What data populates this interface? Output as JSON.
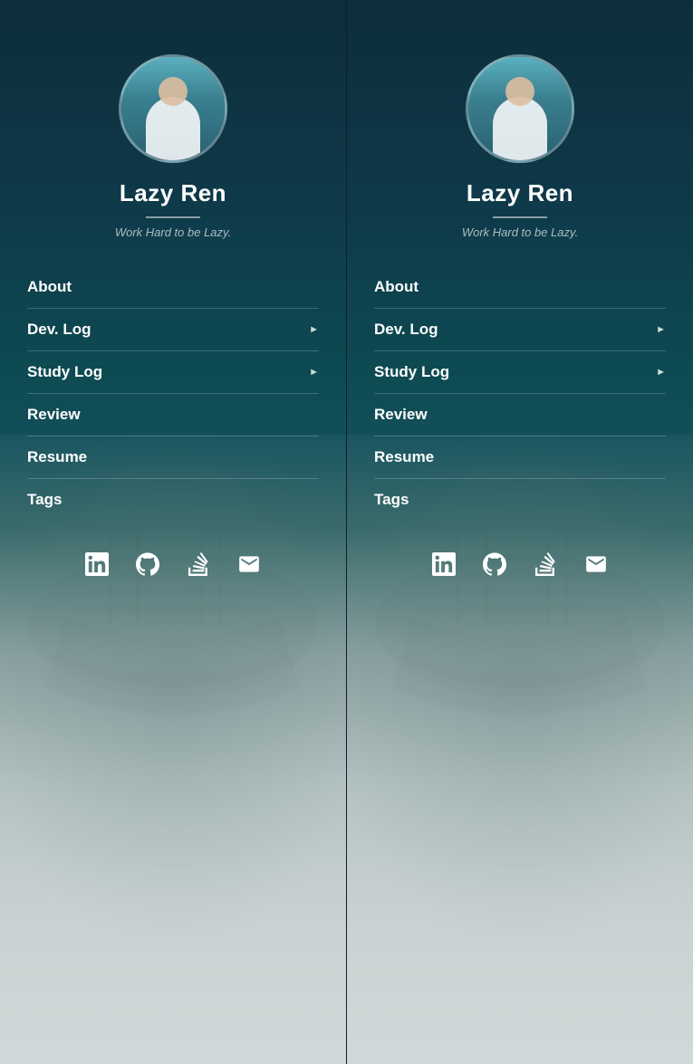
{
  "panels": [
    {
      "id": "panel-left",
      "profile": {
        "name": "Lazy Ren",
        "tagline": "Work Hard to be Lazy."
      },
      "nav": {
        "items": [
          {
            "label": "About",
            "hasArrow": false
          },
          {
            "label": "Dev. Log",
            "hasArrow": true
          },
          {
            "label": "Study Log",
            "hasArrow": true
          },
          {
            "label": "Review",
            "hasArrow": false
          },
          {
            "label": "Resume",
            "hasArrow": false
          },
          {
            "label": "Tags",
            "hasArrow": false
          }
        ]
      },
      "social": {
        "items": [
          {
            "name": "linkedin-icon",
            "label": "LinkedIn"
          },
          {
            "name": "github-icon",
            "label": "GitHub"
          },
          {
            "name": "stackoverflow-icon",
            "label": "Stack Overflow"
          },
          {
            "name": "email-icon",
            "label": "Email"
          }
        ]
      }
    },
    {
      "id": "panel-right",
      "profile": {
        "name": "Lazy Ren",
        "tagline": "Work Hard to be Lazy."
      },
      "nav": {
        "items": [
          {
            "label": "About",
            "hasArrow": false
          },
          {
            "label": "Dev. Log",
            "hasArrow": true
          },
          {
            "label": "Study Log",
            "hasArrow": true
          },
          {
            "label": "Review",
            "hasArrow": false
          },
          {
            "label": "Resume",
            "hasArrow": false
          },
          {
            "label": "Tags",
            "hasArrow": false
          }
        ]
      },
      "social": {
        "items": [
          {
            "name": "linkedin-icon",
            "label": "LinkedIn"
          },
          {
            "name": "github-icon",
            "label": "GitHub"
          },
          {
            "name": "stackoverflow-icon",
            "label": "Stack Overflow"
          },
          {
            "name": "email-icon",
            "label": "Email"
          }
        ]
      }
    }
  ]
}
